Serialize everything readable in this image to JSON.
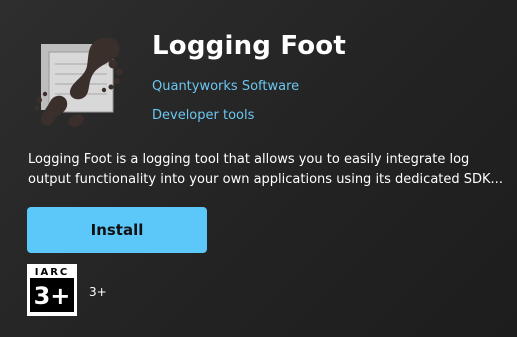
{
  "app": {
    "title": "Logging Foot",
    "publisher": "Quantyworks Software",
    "category": "Developer tools",
    "description_lines": [
      "Logging Foot is a logging tool that allows you to easily integrate log",
      "output functionality into your own applications using its dedicated SDK..."
    ],
    "icon": "footprint-log-icon"
  },
  "actions": {
    "install_label": "Install"
  },
  "rating": {
    "authority": "IARC",
    "badge_value": "3+",
    "label": "3+"
  },
  "colors": {
    "background": "#1f1f1f",
    "link": "#6cc6f0",
    "accent": "#5cc8fa"
  }
}
